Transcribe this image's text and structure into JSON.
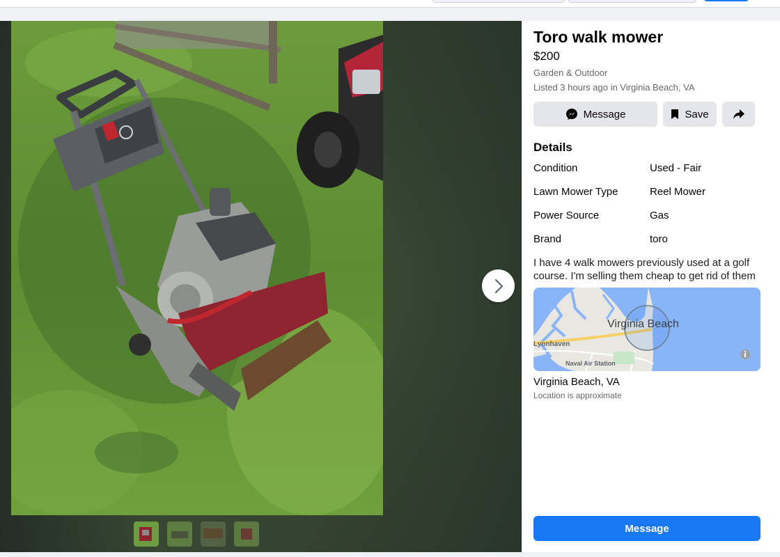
{
  "listing": {
    "title": "Toro walk mower",
    "price": "$200",
    "category": "Garden & Outdoor",
    "listed": "Listed 3 hours ago in Virginia Beach, VA"
  },
  "actions": {
    "message_label": "Message",
    "save_label": "Save",
    "share_icon": "share-icon"
  },
  "details": {
    "heading": "Details",
    "rows": [
      {
        "label": "Condition",
        "value": "Used - Fair"
      },
      {
        "label": "Lawn Mower Type",
        "value": "Reel Mower"
      },
      {
        "label": "Power Source",
        "value": "Gas"
      },
      {
        "label": "Brand",
        "value": "toro"
      }
    ]
  },
  "description": "I have 4 walk mowers previously used at a golf course. I'm selling them cheap to get rid of them",
  "map": {
    "city_label": "Virginia Beach",
    "area_label": "Lynnhaven",
    "station_label": "Naval Air Station"
  },
  "location": {
    "name": "Virginia Beach, VA",
    "note": "Location is approximate"
  },
  "cta_label": "Message",
  "colors": {
    "accent": "#1877f2",
    "secondary_button": "#e4e6eb",
    "water": "#8ab4f8"
  }
}
